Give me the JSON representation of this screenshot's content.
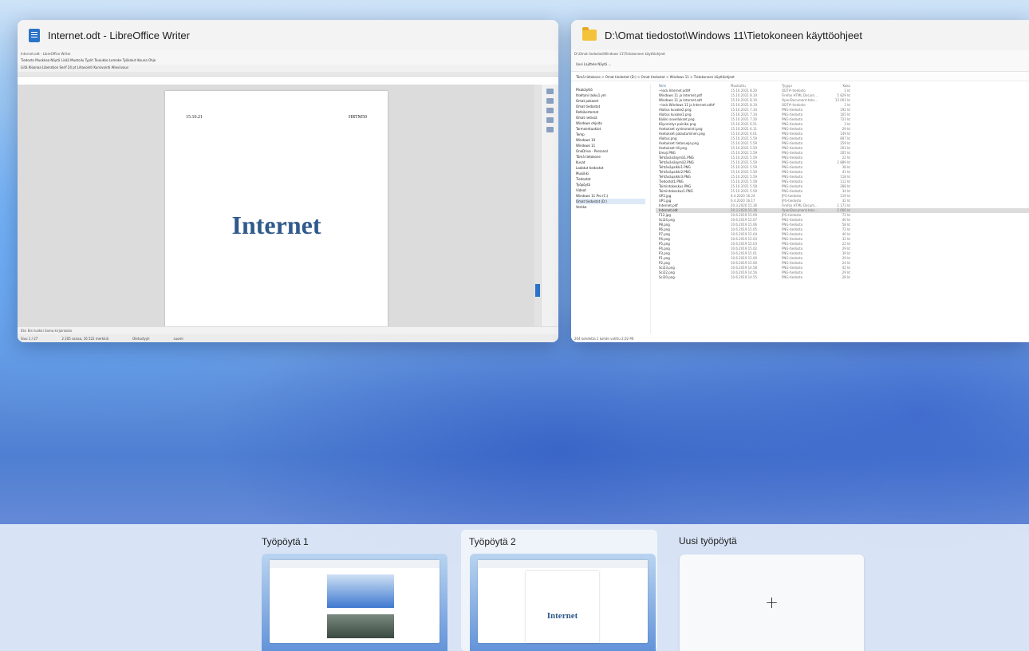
{
  "windows": {
    "writer": {
      "title": "Internet.odt - LibreOffice Writer",
      "inner_title": "Internet.odt - LibreOffice Writer",
      "menu": "Tiedosto  Muokkaa  Näytä  Lisää  Muotoilu  Tyylit  Taulukko  Lomake  Työkalut  Ikkuna  Ohje",
      "toolbar": "Liitä  Kloonaa  Liberation Serif  24 pt  Lihavointi  Kursivointi  Alleviivaus",
      "page_header_left": "15.10.21",
      "page_header_right": "HRTM50",
      "page_heading": "Internet",
      "find_bar": "Etsi   Etsi kaikki   Sama kirjainkoko",
      "status_page": "Sivu 1 / 27",
      "status_words": "2 205 sanaa, 16 522 merkkiä",
      "status_style": "Oletustyyli",
      "status_lang": "suomi"
    },
    "explorer": {
      "title": "D:\\Omat tiedostot\\Windows 11\\Tietokoneen käyttöohjeet",
      "inner_title": "D:\\Omat tiedostot\\Windows 11\\Tietokoneen käyttöohjeet",
      "toolbar": "Uusi   Lajittele   Näytä   ...",
      "address": "Tämä tietokone  >  Omat tiedostot (D:)  >  Omat tiedostot  >  Windows 11  >  Tietokoneen käyttöohjeet",
      "sidebar": [
        {
          "label": "Pikakäyttö",
          "selected": false
        },
        {
          "label": "Itseltani lasku1 ym",
          "selected": false
        },
        {
          "label": "Omat pakaset",
          "selected": false
        },
        {
          "label": "Omat tiedostot",
          "selected": false
        },
        {
          "label": "Retkikertomat",
          "selected": false
        },
        {
          "label": "Omat netissä",
          "selected": false
        },
        {
          "label": "Windows ohjeita",
          "selected": false
        },
        {
          "label": "Tarmoentuokiot",
          "selected": false
        },
        {
          "label": "Temp",
          "selected": false
        },
        {
          "label": "Windows 10",
          "selected": false
        },
        {
          "label": "Windows 11",
          "selected": false
        },
        {
          "label": "OneDrive - Personal",
          "selected": false
        },
        {
          "label": "Tämä tietokone",
          "selected": false
        },
        {
          "label": "Kuvat",
          "selected": false
        },
        {
          "label": "Ladatut tiedostot",
          "selected": false
        },
        {
          "label": "Musiikki",
          "selected": false
        },
        {
          "label": "Tiedostot",
          "selected": false
        },
        {
          "label": "Työpöytä",
          "selected": false
        },
        {
          "label": "Videot",
          "selected": false
        },
        {
          "label": "Windows 11 Pro (C:)",
          "selected": false
        },
        {
          "label": "Omat tiedostot (D:)",
          "selected": true
        },
        {
          "label": "Verkko",
          "selected": false
        }
      ],
      "columns": [
        "Nimi",
        "Muokattu",
        "Tyyppi",
        "Koko"
      ],
      "files": [
        [
          "~lock.Internet.odt#",
          "15.10.2021 8.20",
          "ODT#-tiedosto",
          "1 kt"
        ],
        [
          "Windows 11 ja Internet.pdf",
          "15.10.2021 8.10",
          "Firefox HTML Docum...",
          "5 829 kt"
        ],
        [
          "Windows 11 ja Internet.odt",
          "15.10.2021 8.10",
          "OpenDocument-teks...",
          "13 001 kt"
        ],
        [
          "~lock.Windows 11 ja Internet.odt#",
          "15.10.2021 8.10",
          "ODT#-tiedosto",
          "1 kt"
        ],
        [
          "Aloitus kuvake2.png",
          "15.10.2021 7.34",
          "PNG-tiedosto",
          "192 kt"
        ],
        [
          "Aloitus kuvake1.png",
          "15.10.2021 7.34",
          "PNG-tiedosto",
          "165 kt"
        ],
        [
          "Kaikki sovellukset.png",
          "15.10.2021 7.20",
          "PNG-tiedosto",
          "723 kt"
        ],
        [
          "Käynnistys painike.png",
          "15.10.2021 6.51",
          "PNG-tiedosto",
          "3 kt"
        ],
        [
          "Asetukset synkronointi.png",
          "15.10.2021 6.11",
          "PNG-tiedosto",
          "29 kt"
        ],
        [
          "Asetukset palautuminen.png",
          "15.10.2021 6.01",
          "PNG-tiedosto",
          "149 kt"
        ],
        [
          "Aloitus.png",
          "15.10.2021 5.59",
          "PNG-tiedosto",
          "807 kt"
        ],
        [
          "Asetukset tietosuoja.png",
          "15.10.2021 5.59",
          "PNG-tiedosto",
          "259 kt"
        ],
        [
          "Asetukset tili.png",
          "15.10.2021 5.59",
          "PNG-tiedosto",
          "203 kt"
        ],
        [
          "Emoji.PNG",
          "15.10.2021 5.59",
          "PNG-tiedosto",
          "205 kt"
        ],
        [
          "Tehtävänäkymä1.PNG",
          "15.10.2021 5.59",
          "PNG-tiedosto",
          "22 kt"
        ],
        [
          "Tehtävänäkymä2.PNG",
          "15.10.2021 5.59",
          "PNG-tiedosto",
          "2 889 kt"
        ],
        [
          "Tehtäväpalkki1.PNG",
          "15.10.2021 5.59",
          "PNG-tiedosto",
          "38 kt"
        ],
        [
          "Tehtäväpalkki2.PNG",
          "15.10.2021 5.59",
          "PNG-tiedosto",
          "41 kt"
        ],
        [
          "Tehtäväpalkki3.PNG",
          "15.10.2021 5.59",
          "PNG-tiedosto",
          "118 kt"
        ],
        [
          "Tiedostot1.PNG",
          "15.10.2021 5.58",
          "PNG-tiedosto",
          "112 kt"
        ],
        [
          "Toimintokeskus.PNG",
          "15.10.2021 5.58",
          "PNG-tiedosto",
          "288 kt"
        ],
        [
          "Toimintokeskus1.PNG",
          "15.10.2021 5.59",
          "PNG-tiedosto",
          "34 kt"
        ],
        [
          "UP2.jpg",
          "6.4.2020 16.24",
          "JPG-tiedosto",
          "119 kt"
        ],
        [
          "UP1.jpg",
          "6.4.2020 16.17",
          "JPG-tiedosto",
          "32 kt"
        ],
        [
          "Internet.pdf",
          "20.3.2020 15.36",
          "Firefox HTML Docum...",
          "1 173 kt"
        ],
        [
          "Internet.odt",
          "20.3.2020 15.36",
          "OpenDocument-teks...",
          "2 006 kt"
        ],
        [
          "F12.jpg",
          "10.6.2019 15.09",
          "JPG-tiedosto",
          "72 kt"
        ],
        [
          "Sci24.png",
          "10.6.2019 15.07",
          "PNG-tiedosto",
          "40 kt"
        ],
        [
          "P8.png",
          "10.6.2019 15.06",
          "PNG-tiedosto",
          "58 kt"
        ],
        [
          "P6.png",
          "10.6.2019 15.05",
          "PNG-tiedosto",
          "72 kt"
        ],
        [
          "P7.png",
          "10.6.2019 15.04",
          "PNG-tiedosto",
          "40 kt"
        ],
        [
          "P4.png",
          "10.6.2019 15.03",
          "PNG-tiedosto",
          "32 kt"
        ],
        [
          "P5.png",
          "10.6.2019 15.03",
          "PNG-tiedosto",
          "22 kt"
        ],
        [
          "P4.png",
          "10.6.2019 15.02",
          "PNG-tiedosto",
          "29 kt"
        ],
        [
          "P3.png",
          "10.6.2019 15.01",
          "PNG-tiedosto",
          "39 kt"
        ],
        [
          "P1.png",
          "10.6.2019 15.00",
          "PNG-tiedosto",
          "29 kt"
        ],
        [
          "P2.png",
          "10.6.2019 15.00",
          "PNG-tiedosto",
          "24 kt"
        ],
        [
          "Sci23.png",
          "10.6.2019 14.58",
          "PNG-tiedosto",
          "42 kt"
        ],
        [
          "Sci22.png",
          "10.6.2019 14.56",
          "PNG-tiedosto",
          "29 kt"
        ],
        [
          "Sci20.png",
          "10.6.2019 14.55",
          "PNG-tiedosto",
          "28 kt"
        ]
      ],
      "selected_file_index": 25,
      "status": "204 kohdetta    1 kohde valittu 2,02 Mt"
    }
  },
  "desktops": [
    {
      "label": "Työpöytä 1",
      "active": false
    },
    {
      "label": "Työpöytä 2",
      "active": true
    }
  ],
  "new_desktop": {
    "label": "Uusi työpöytä",
    "plus": "+"
  },
  "thumb2_heading": "Internet"
}
